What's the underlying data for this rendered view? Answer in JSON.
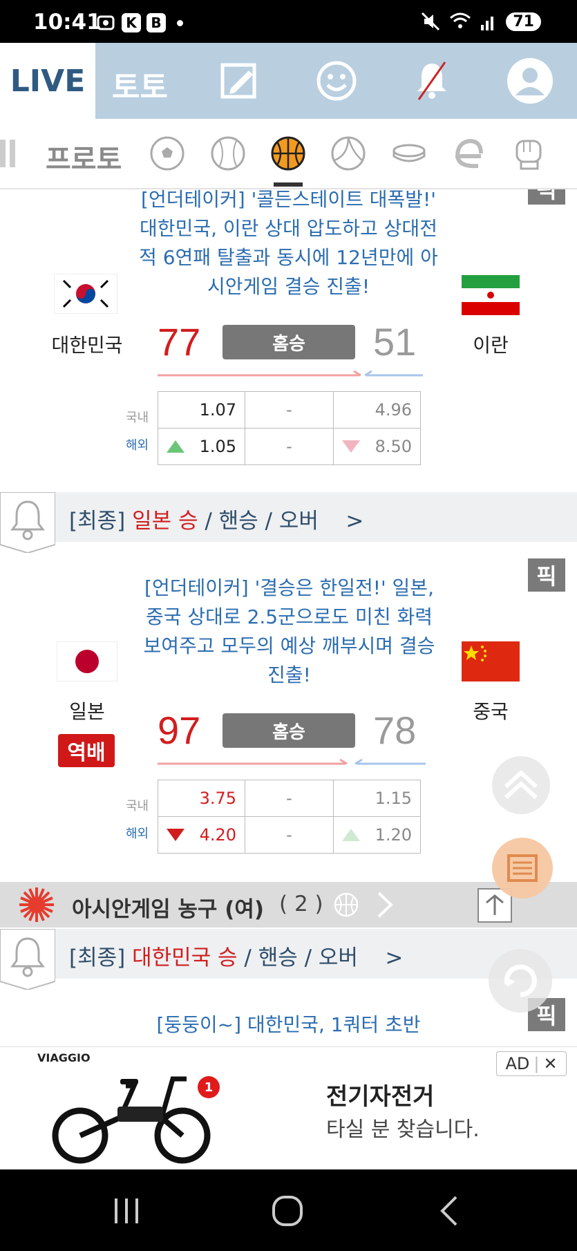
{
  "status_bar": {
    "time": "10:41",
    "icon_k": "K",
    "icon_b": "B",
    "battery": "71"
  },
  "top_nav": {
    "live": "LIVE",
    "toto": "토토"
  },
  "sports_bar": {
    "proto": "프로토",
    "active_sport": "basketball"
  },
  "game1": {
    "headline": "[언더테이커] '콜든스테이트 대폭발!' 대한민국, 이란 상대 압도하고 상대전적 6연패 탈출과 동시에 12년만에 아시안게임 결승 진출!",
    "home_team": "대한민국",
    "away_team": "이란",
    "home_score": "77",
    "away_score": "51",
    "result": "홈승",
    "domestic_label": "국내",
    "overseas_label": "해외",
    "domestic_odds": [
      "1.07",
      "-",
      "4.96"
    ],
    "overseas_odds": [
      "1.05",
      "-",
      "8.50"
    ]
  },
  "final1": {
    "prefix": "[최종]",
    "highlight": "일본 승",
    "rest": " / 핸승 / 오버",
    "arrow": ">"
  },
  "game2": {
    "pick": "픽",
    "headline": "[언더테이커] '결승은 한일전!' 일본, 중국 상대로 2.5군으로도 미친 화력 보여주고 모두의 예상 깨부시며 결승 진출!",
    "home_team": "일본",
    "away_team": "중국",
    "badge": "역배",
    "home_score": "97",
    "away_score": "78",
    "result": "홈승",
    "domestic_label": "국내",
    "overseas_label": "해외",
    "domestic_odds": [
      "3.75",
      "-",
      "1.15"
    ],
    "overseas_odds": [
      "4.20",
      "-",
      "1.20"
    ]
  },
  "league": {
    "title": "아시안게임 농구 (여)",
    "count": "( 2 )"
  },
  "final2": {
    "prefix": "[최종]",
    "highlight": "대한민국 승",
    "rest": " / 핸승 / 오버",
    "arrow": ">"
  },
  "game3": {
    "headline": "[둥둥이~] 대한민국, 1쿼터 초반",
    "pick": "픽"
  },
  "ad": {
    "brand": "VIAGGIO",
    "notif": "1",
    "title": "전기자전거",
    "subtitle": "타실 분 찾습니다.",
    "tag": "AD",
    "close": "✕"
  },
  "colors": {
    "live_blue": "#2f5a82",
    "nav_bg": "#b9cfe0",
    "win_red": "#d21d1d",
    "headline_blue": "#2b6cb0"
  }
}
